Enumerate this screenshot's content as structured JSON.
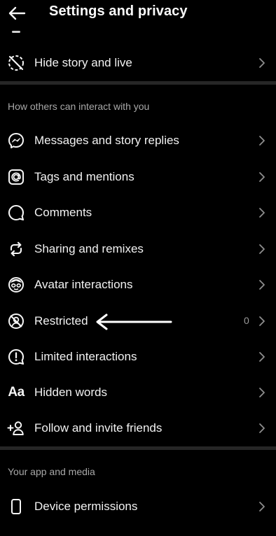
{
  "header": {
    "title": "Settings and privacy",
    "back_icon": "arrow-left-icon"
  },
  "top_rows": [
    {
      "label": "Hide story and live",
      "icon": "hide-story-icon"
    }
  ],
  "sections": [
    {
      "title": "How others can interact with you",
      "items": [
        {
          "label": "Messages and story replies",
          "icon": "messenger-icon"
        },
        {
          "label": "Tags and mentions",
          "icon": "at-sign-icon"
        },
        {
          "label": "Comments",
          "icon": "comment-icon"
        },
        {
          "label": "Sharing and remixes",
          "icon": "remix-icon"
        },
        {
          "label": "Avatar interactions",
          "icon": "avatar-icon"
        },
        {
          "label": "Restricted",
          "icon": "restricted-icon",
          "count": "0"
        },
        {
          "label": "Limited interactions",
          "icon": "limited-interactions-icon"
        },
        {
          "label": "Hidden words",
          "icon": "hidden-words-icon",
          "glyph": "Aa"
        },
        {
          "label": "Follow and invite friends",
          "icon": "add-person-icon"
        }
      ]
    },
    {
      "title": "Your app and media",
      "items": [
        {
          "label": "Device permissions",
          "icon": "phone-icon"
        }
      ]
    }
  ],
  "annotation": {
    "icon": "pointing-arrow-icon"
  },
  "colors": {
    "background": "#000000",
    "divider": "#262626",
    "secondary_text": "#a8a8a8"
  }
}
